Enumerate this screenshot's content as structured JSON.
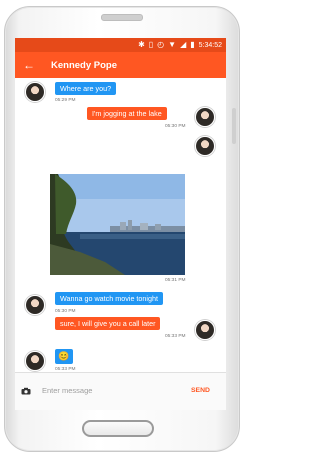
{
  "status_bar": {
    "time": "5:34:52"
  },
  "app_bar": {
    "title": "Kennedy Pope"
  },
  "messages": [
    {
      "text": "Where are you?",
      "time": "05:29 PM"
    },
    {
      "text": "I'm jogging at the lake",
      "time": "05:30 PM"
    },
    {
      "text": "",
      "time": "05:31 PM"
    },
    {
      "text": "Wanna go watch movie tonight",
      "time": "05:30 PM"
    },
    {
      "text": "sure, I will give you a call later",
      "time": "05:33 PM"
    },
    {
      "text": "",
      "time": "05:33 PM"
    }
  ],
  "input": {
    "placeholder": "Enter message",
    "send_label": "SEND"
  },
  "colors": {
    "primary": "#ff5722",
    "primary_dark": "#e64a19",
    "incoming": "#2196f3",
    "outgoing": "#ff5722"
  },
  "icons": [
    "back-arrow-icon",
    "camera-icon",
    "bluetooth-icon",
    "vibrate-icon",
    "alarm-icon",
    "wifi-icon",
    "signal-icon",
    "battery-icon"
  ]
}
